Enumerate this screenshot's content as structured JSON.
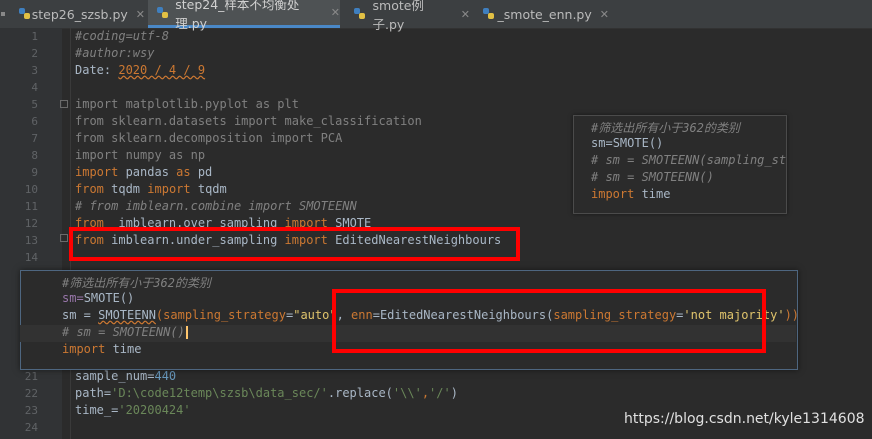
{
  "tabs": [
    {
      "label": "step26_szsb.py",
      "active": false
    },
    {
      "label": "step24_样本不均衡处理.py",
      "active": true
    },
    {
      "label": "smote例子.py",
      "active": false
    },
    {
      "label": "_smote_enn.py",
      "active": false
    }
  ],
  "line_numbers": [
    "1",
    "2",
    "3",
    "4",
    "5",
    "6",
    "7",
    "8",
    "9",
    "10",
    "11",
    "12",
    "13",
    "14",
    "21",
    "22",
    "23",
    "24"
  ],
  "editor": {
    "l1": "#coding=utf-8",
    "l2": "#author:wsy",
    "l3_pre": "Date: ",
    "l3_date": "2020 / 4 / 9",
    "l5_kw": "import",
    "l5_rest": " matplotlib.pyplot as plt",
    "l6_kw": "from",
    "l6_rest": " sklearn.datasets import make_classification",
    "l7_kw": "from",
    "l7_rest": " sklearn.decomposition import PCA",
    "l8_kw": "import",
    "l8_rest": " numpy as np",
    "l9_kw": "import",
    "l9_mid": " pandas ",
    "l9_kw2": "as",
    "l9_end": " pd",
    "l10_kw": "from",
    "l10_mid": " tqdm ",
    "l10_kw2": "import",
    "l10_end": " tqdm",
    "l11": "# from imblearn.combine import SMOTEENN",
    "l12_kw": "from",
    "l12_mid": "  imblearn.over_sampling ",
    "l12_kw2": "import",
    "l12_end": " SMOTE",
    "l13_kw": "from",
    "l13_mid": " imblearn.under_sampling ",
    "l13_kw2": "import",
    "l13_end": " EditedNearestNeighbours",
    "l21_pre": "sample_num=",
    "l21_num": "440",
    "l22_pre": "path=",
    "l22_str": "'D:\\code12temp\\szsb\\data_sec/'",
    "l22_mid": ".replace(",
    "l22_s1": "'\\\\'",
    "l22_comma": ",",
    "l22_s2": "'/'",
    "l22_end": ")",
    "l23_pre": "time_=",
    "l23_str": "'20200424'"
  },
  "popup": {
    "p1": "#筛选出所有小于362的类别",
    "p2_pre": "sm=",
    "p2_fn": "SMOTE",
    "p2_end": "()",
    "p3_pre": "sm = ",
    "p3_fn": "SMOTEENN",
    "p3_a": "(",
    "p3_kw": "sampling_strategy",
    "p3_eq": "=",
    "p3_str": "\"auto\"",
    "p3_c": ", ",
    "p3_kw2": "enn",
    "p3_eq2": "=EditedNearestNeighbours(",
    "p3_kw3": "sampling_strategy",
    "p3_eq3": "=",
    "p3_str2": "'not majority'",
    "p3_end": "))",
    "p4": "# sm = SMOTEENN()",
    "p5_kw": "import",
    "p5_rest": " time"
  },
  "panel": {
    "q1": "#筛选出所有小于362的类别",
    "q2_pre": "sm=",
    "q2_fn": "SMOTE",
    "q2_end": "()",
    "q3": "# sm = SMOTEENN(sampling_str",
    "q4": "# sm = SMOTEENN()",
    "q5_kw": "import",
    "q5_rest": " time"
  },
  "watermark": "https://blog.csdn.net/kyle1314608",
  "colors": {
    "highlight": "#ff0000",
    "keyword": "#cc7832",
    "comment": "#808080",
    "string": "#6a8759",
    "number": "#6897bb"
  }
}
